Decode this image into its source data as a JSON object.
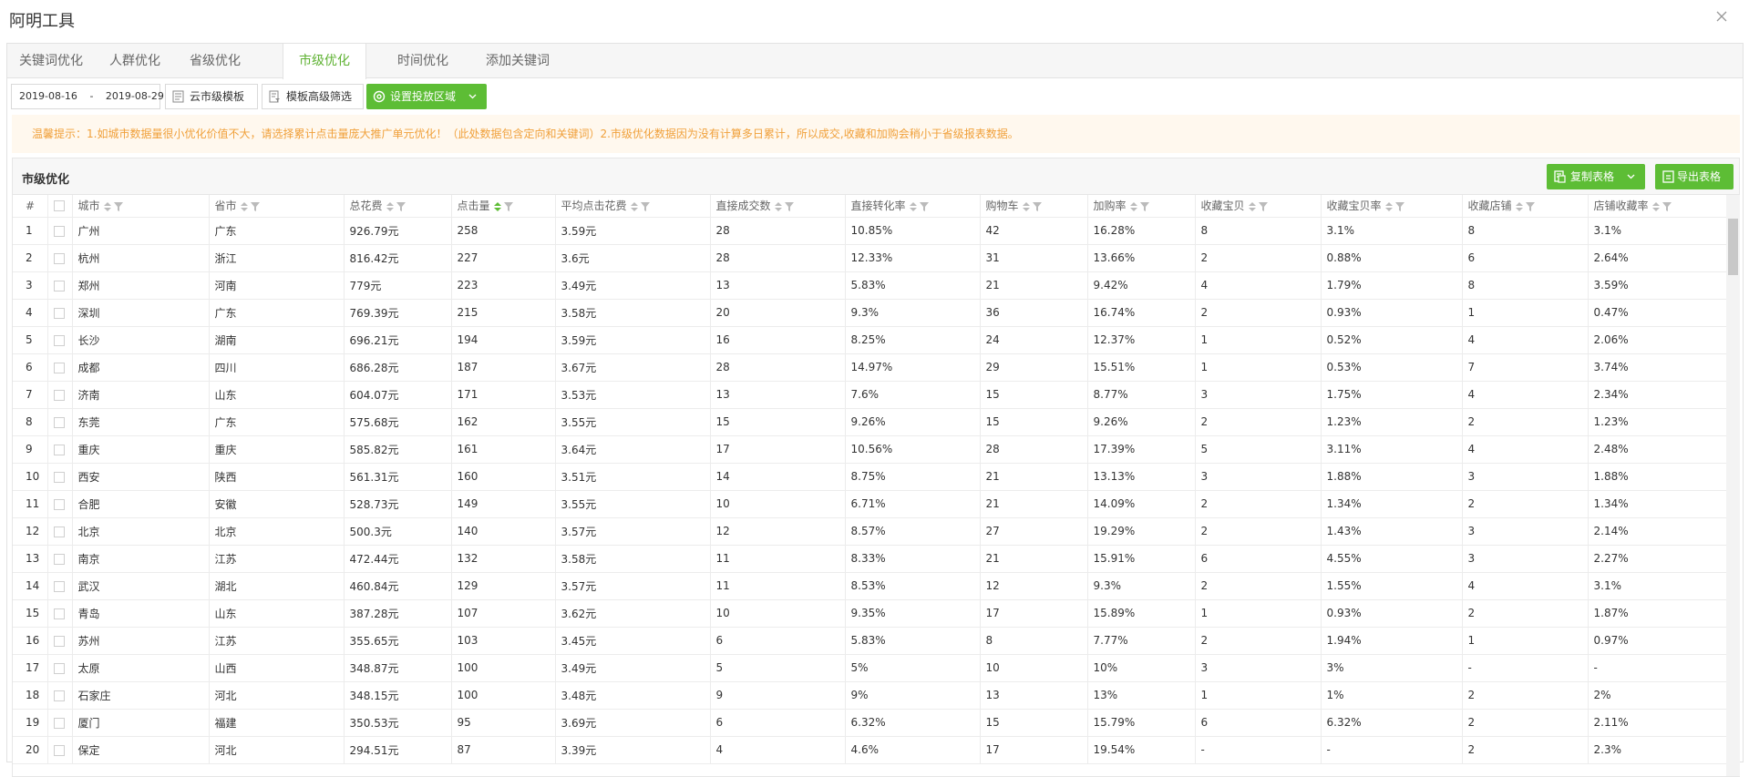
{
  "app": {
    "title": "阿明工具"
  },
  "tabs": [
    {
      "label": "关键词优化"
    },
    {
      "label": "人群优化"
    },
    {
      "label": "省级优化"
    },
    {
      "label": "市级优化"
    },
    {
      "label": "时间优化"
    },
    {
      "label": "添加关键词"
    }
  ],
  "active_tab": "市级优化",
  "toolbar": {
    "date_start": "2019-08-16",
    "date_sep": "-",
    "date_end": "2019-08-29",
    "template_btn": "云市级模板",
    "filter_btn": "模板高级筛选",
    "region_btn": "设置投放区域"
  },
  "notice": "温馨提示：1.如城市数据量很小优化价值不大，请选择累计点击量庞大推广单元优化！（此处数据包含定向和关键词）2.市级优化数据因为没有计算多日累计，所以成交,收藏和加购会稍小于省级报表数据。",
  "section": {
    "title": "市级优化",
    "copy_btn": "复制表格",
    "export_btn": "导出表格"
  },
  "table": {
    "headers": [
      "#",
      "",
      "城市",
      "省市",
      "总花费",
      "点击量",
      "平均点击花费",
      "直接成交数",
      "直接转化率",
      "购物车",
      "加购率",
      "收藏宝贝",
      "收藏宝贝率",
      "收藏店铺",
      "店铺收藏率"
    ],
    "rows": [
      [
        "1",
        "广州",
        "广东",
        "926.79元",
        "258",
        "3.59元",
        "28",
        "10.85%",
        "42",
        "16.28%",
        "8",
        "3.1%",
        "8",
        "3.1%"
      ],
      [
        "2",
        "杭州",
        "浙江",
        "816.42元",
        "227",
        "3.6元",
        "28",
        "12.33%",
        "31",
        "13.66%",
        "2",
        "0.88%",
        "6",
        "2.64%"
      ],
      [
        "3",
        "郑州",
        "河南",
        "779元",
        "223",
        "3.49元",
        "13",
        "5.83%",
        "21",
        "9.42%",
        "4",
        "1.79%",
        "8",
        "3.59%"
      ],
      [
        "4",
        "深圳",
        "广东",
        "769.39元",
        "215",
        "3.58元",
        "20",
        "9.3%",
        "36",
        "16.74%",
        "2",
        "0.93%",
        "1",
        "0.47%"
      ],
      [
        "5",
        "长沙",
        "湖南",
        "696.21元",
        "194",
        "3.59元",
        "16",
        "8.25%",
        "24",
        "12.37%",
        "1",
        "0.52%",
        "4",
        "2.06%"
      ],
      [
        "6",
        "成都",
        "四川",
        "686.28元",
        "187",
        "3.67元",
        "28",
        "14.97%",
        "29",
        "15.51%",
        "1",
        "0.53%",
        "7",
        "3.74%"
      ],
      [
        "7",
        "济南",
        "山东",
        "604.07元",
        "171",
        "3.53元",
        "13",
        "7.6%",
        "15",
        "8.77%",
        "3",
        "1.75%",
        "4",
        "2.34%"
      ],
      [
        "8",
        "东莞",
        "广东",
        "575.68元",
        "162",
        "3.55元",
        "15",
        "9.26%",
        "15",
        "9.26%",
        "2",
        "1.23%",
        "2",
        "1.23%"
      ],
      [
        "9",
        "重庆",
        "重庆",
        "585.82元",
        "161",
        "3.64元",
        "17",
        "10.56%",
        "28",
        "17.39%",
        "5",
        "3.11%",
        "4",
        "2.48%"
      ],
      [
        "10",
        "西安",
        "陕西",
        "561.31元",
        "160",
        "3.51元",
        "14",
        "8.75%",
        "21",
        "13.13%",
        "3",
        "1.88%",
        "3",
        "1.88%"
      ],
      [
        "11",
        "合肥",
        "安徽",
        "528.73元",
        "149",
        "3.55元",
        "10",
        "6.71%",
        "21",
        "14.09%",
        "2",
        "1.34%",
        "2",
        "1.34%"
      ],
      [
        "12",
        "北京",
        "北京",
        "500.3元",
        "140",
        "3.57元",
        "12",
        "8.57%",
        "27",
        "19.29%",
        "2",
        "1.43%",
        "3",
        "2.14%"
      ],
      [
        "13",
        "南京",
        "江苏",
        "472.44元",
        "132",
        "3.58元",
        "11",
        "8.33%",
        "21",
        "15.91%",
        "6",
        "4.55%",
        "3",
        "2.27%"
      ],
      [
        "14",
        "武汉",
        "湖北",
        "460.84元",
        "129",
        "3.57元",
        "11",
        "8.53%",
        "12",
        "9.3%",
        "2",
        "1.55%",
        "4",
        "3.1%"
      ],
      [
        "15",
        "青岛",
        "山东",
        "387.28元",
        "107",
        "3.62元",
        "10",
        "9.35%",
        "17",
        "15.89%",
        "1",
        "0.93%",
        "2",
        "1.87%"
      ],
      [
        "16",
        "苏州",
        "江苏",
        "355.65元",
        "103",
        "3.45元",
        "6",
        "5.83%",
        "8",
        "7.77%",
        "2",
        "1.94%",
        "1",
        "0.97%"
      ],
      [
        "17",
        "太原",
        "山西",
        "348.87元",
        "100",
        "3.49元",
        "5",
        "5%",
        "10",
        "10%",
        "3",
        "3%",
        "-",
        "-"
      ],
      [
        "18",
        "石家庄",
        "河北",
        "348.15元",
        "100",
        "3.48元",
        "9",
        "9%",
        "13",
        "13%",
        "1",
        "1%",
        "2",
        "2%"
      ],
      [
        "19",
        "厦门",
        "福建",
        "350.53元",
        "95",
        "3.69元",
        "6",
        "6.32%",
        "15",
        "15.79%",
        "6",
        "6.32%",
        "2",
        "2.11%"
      ],
      [
        "20",
        "保定",
        "河北",
        "294.51元",
        "87",
        "3.39元",
        "4",
        "4.6%",
        "17",
        "19.54%",
        "-",
        "-",
        "2",
        "2.3%"
      ]
    ]
  },
  "colors": {
    "accent": "#5dbd35",
    "tab_active": "#5fb233",
    "notice_bg": "#fff8ee",
    "notice_text": "#f0a03a"
  },
  "icons": {
    "close": "close-icon",
    "template": "document-icon",
    "filter": "filter-doc-icon",
    "region": "settings-gear-icon",
    "copy": "copy-icon",
    "export": "export-icon"
  }
}
